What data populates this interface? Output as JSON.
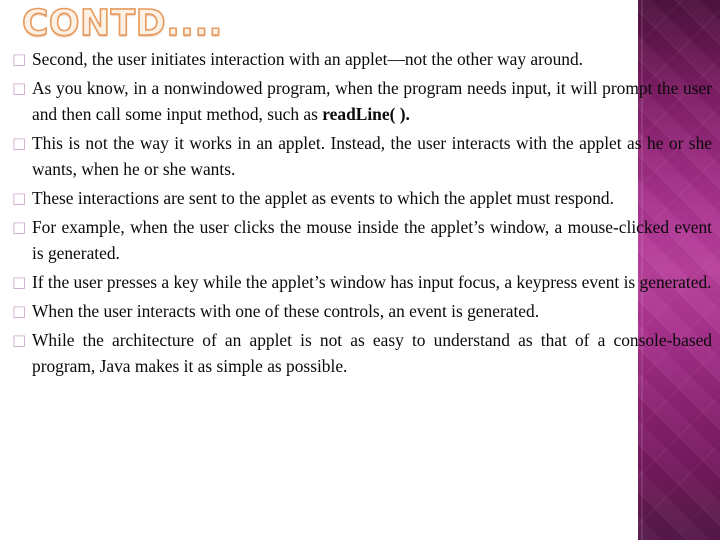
{
  "slide": {
    "title": "CONTD....",
    "bullet_glyph": "□",
    "accent_band_color": "#b8409b",
    "band_top_color": "#4e1340",
    "band_bottom_color": "#55184a",
    "title_fill_color": "#fdf0e4",
    "title_outline_color": "#e79b5e",
    "bullet_color": "#c9a8c9",
    "text_color": "#0a0a0a",
    "background_color": "#ffffff"
  },
  "bullets": [
    {
      "id": "bullet-1",
      "text": "Second, the user initiates interaction with an applet—not the other way around.",
      "justified": false,
      "bold_run": ""
    },
    {
      "id": "bullet-2",
      "text_before": "As you know, in a nonwindowed program, when the program needs input, it will prompt the user and then call some input method, such as ",
      "bold_run": "readLine( ).",
      "text_after": "",
      "justified": true
    },
    {
      "id": "bullet-3",
      "text": "This is not the way it works in an applet. Instead, the user interacts with the applet as he or she wants, when he or she wants.",
      "justified": true,
      "bold_run": ""
    },
    {
      "id": "bullet-4",
      "text": "These interactions are sent to the applet as events to which the applet must respond.",
      "justified": false,
      "bold_run": ""
    },
    {
      "id": "bullet-5",
      "text": "For example, when the user clicks the mouse inside the applet’s window, a mouse-clicked event is generated.",
      "justified": true,
      "bold_run": ""
    },
    {
      "id": "bullet-6",
      "text": "If the user presses a key while the applet’s window has input focus, a keypress event is generated.",
      "justified": true,
      "bold_run": ""
    },
    {
      "id": "bullet-7",
      "text": "When the user interacts with one of these controls, an event is generated.",
      "justified": false,
      "bold_run": ""
    },
    {
      "id": "bullet-8",
      "text": "While the architecture of an applet is not as easy to understand as that of a console-based program, Java makes it as simple as possible.",
      "justified": true,
      "bold_run": ""
    }
  ]
}
